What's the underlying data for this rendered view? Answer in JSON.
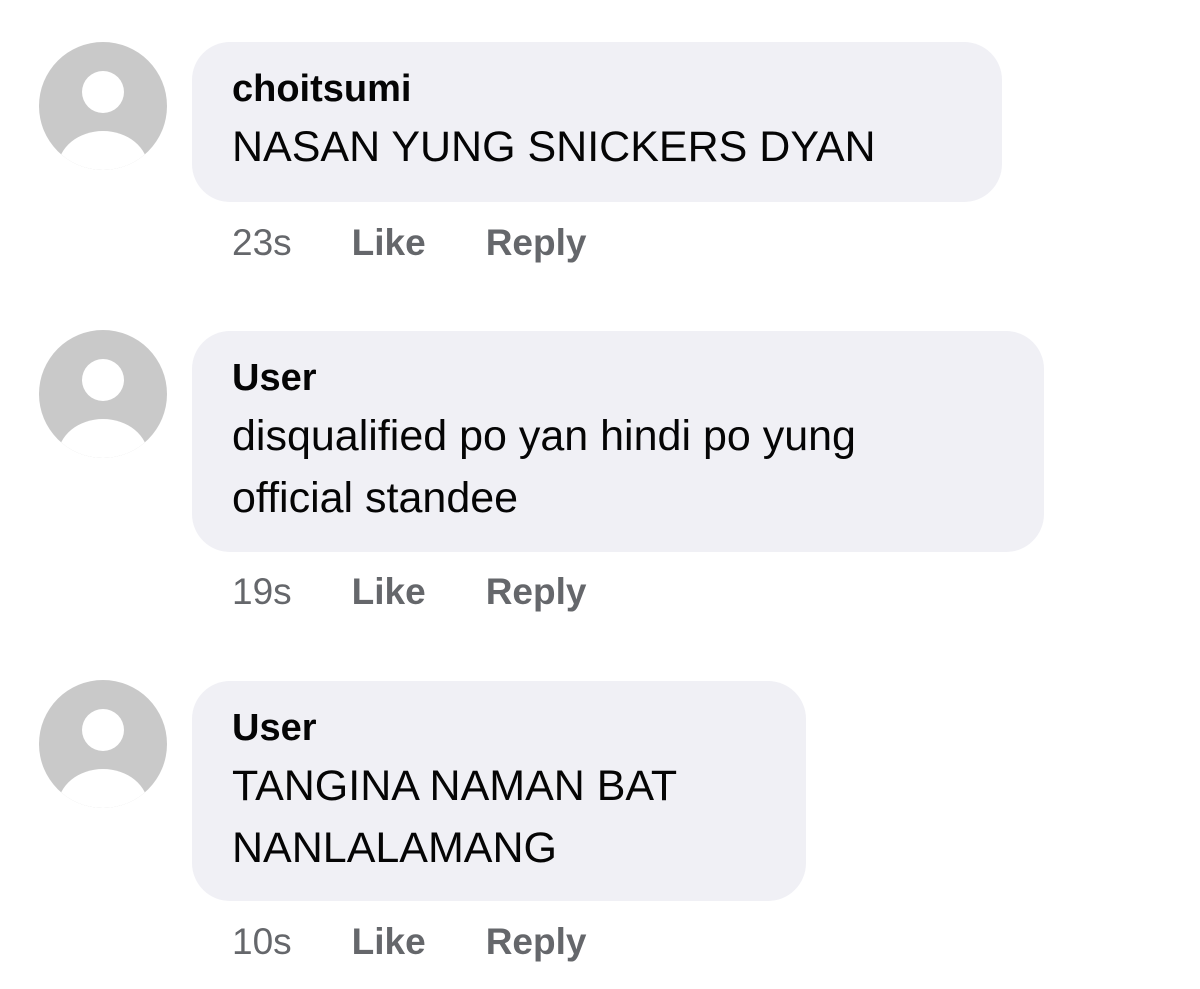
{
  "comments": [
    {
      "avatar_icon": "default-user-avatar-icon",
      "author": "choitsumi",
      "lines": [
        "NASAN YUNG SNICKERS DYAN"
      ],
      "time": "23s",
      "like_label": "Like",
      "reply_label": "Reply"
    },
    {
      "avatar_icon": "default-user-avatar-icon",
      "author": "User",
      "lines": [
        "disqualified po yan hindi po yung",
        "official standee"
      ],
      "time": "19s",
      "like_label": "Like",
      "reply_label": "Reply"
    },
    {
      "avatar_icon": "default-user-avatar-icon",
      "author": "User",
      "lines": [
        "TANGINA NAMAN BAT",
        "NANLALAMANG"
      ],
      "time": "10s",
      "like_label": "Like",
      "reply_label": "Reply"
    }
  ],
  "colors": {
    "bubble_background": "#f0f0f5",
    "avatar_background": "#c9c9c9",
    "avatar_silhouette": "#ffffff",
    "meta_text": "#65676b",
    "primary_text": "#050505"
  }
}
